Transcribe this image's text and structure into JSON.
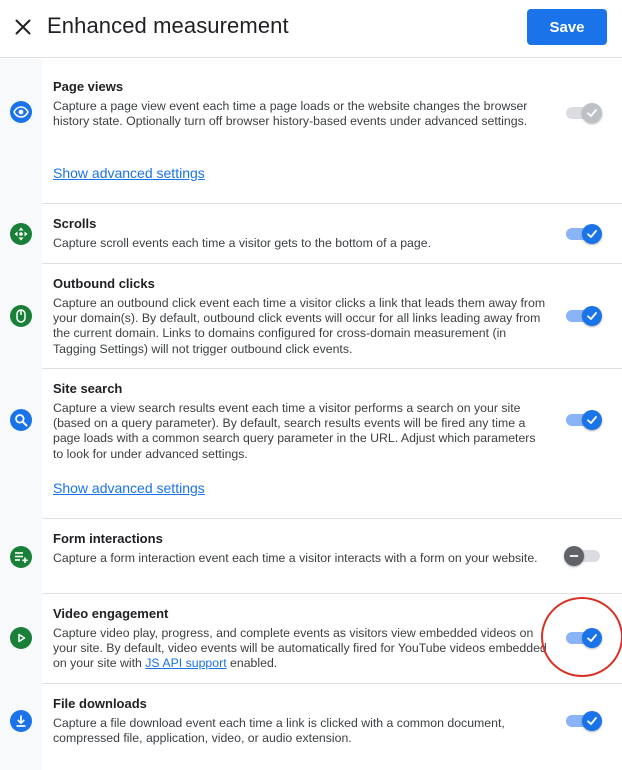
{
  "header": {
    "title": "Enhanced measurement",
    "save_label": "Save"
  },
  "colors": {
    "accent": "#1a73e8",
    "icon_green": "#188038",
    "highlight": "#d93025"
  },
  "settings": [
    {
      "title": "Page views",
      "description": "Capture a page view event each time a page loads or the website changes the browser history state. Optionally turn off browser history-based events under advanced settings.",
      "advanced_link": "Show advanced settings",
      "icon": "eye-icon",
      "state": "on-disabled"
    },
    {
      "title": "Scrolls",
      "description": "Capture scroll events each time a visitor gets to the bottom of a page.",
      "icon": "scroll-icon",
      "state": "on"
    },
    {
      "title": "Outbound clicks",
      "description": "Capture an outbound click event each time a visitor clicks a link that leads them away from your domain(s). By default, outbound click events will occur for all links leading away from the current domain. Links to domains configured for cross-domain measurement (in Tagging Settings) will not trigger outbound click events.",
      "icon": "mouse-icon",
      "state": "on"
    },
    {
      "title": "Site search",
      "description": "Capture a view search results event each time a visitor performs a search on your site (based on a query parameter). By default, search results events will be fired any time a page loads with a common search query parameter in the URL. Adjust which parameters to look for under advanced settings.",
      "advanced_link": "Show advanced settings",
      "icon": "search-icon",
      "state": "on"
    },
    {
      "title": "Form interactions",
      "description": "Capture a form interaction event each time a visitor interacts with a form on your website.",
      "icon": "form-icon",
      "state": "off"
    },
    {
      "title": "Video engagement",
      "description_prefix": "Capture video play, progress, and complete events as visitors view embedded videos on your site. By default, video events will be automatically fired for YouTube videos embedded on your site with ",
      "description_link": "JS API support",
      "description_suffix": " enabled.",
      "icon": "play-icon",
      "state": "on"
    },
    {
      "title": "File downloads",
      "description": "Capture a file download event each time a link is clicked with a common document, compressed file, application, video, or audio extension.",
      "icon": "download-icon",
      "state": "on"
    }
  ]
}
